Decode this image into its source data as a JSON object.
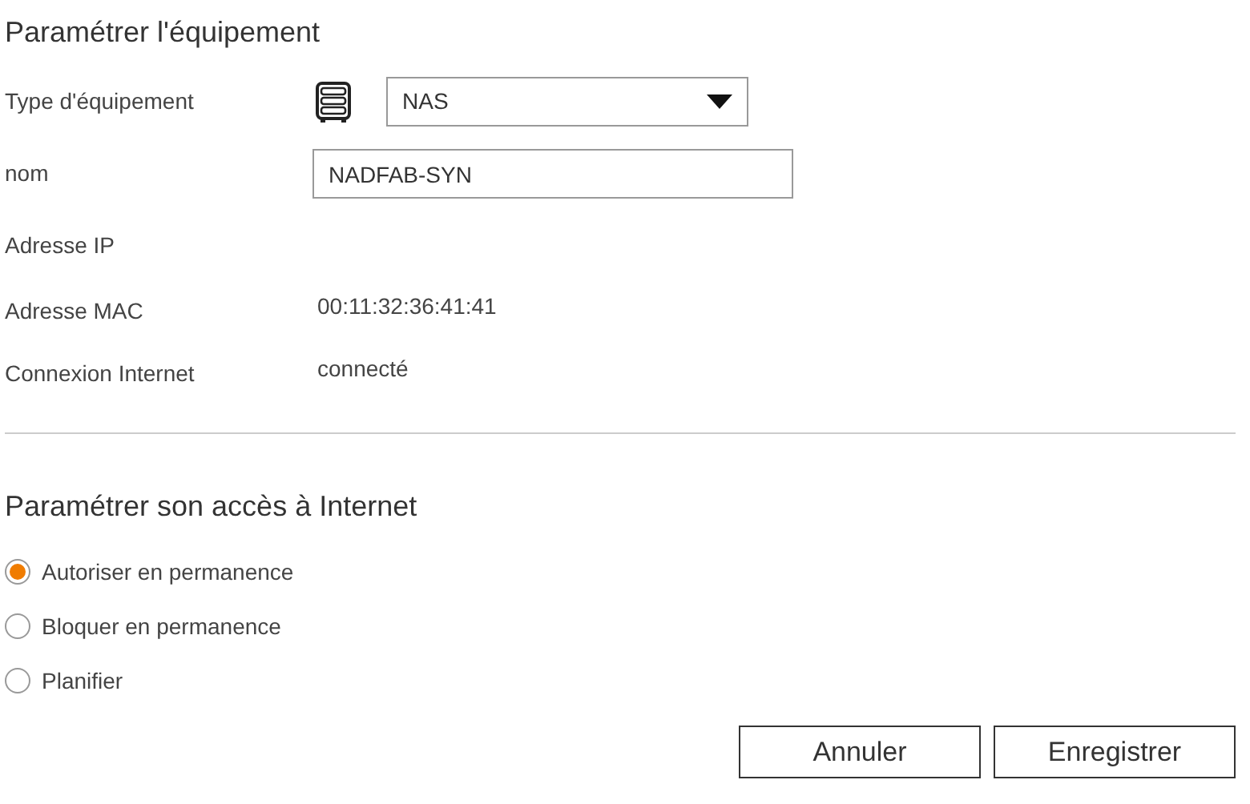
{
  "device_section": {
    "title": "Paramétrer l'équipement",
    "fields": [
      {
        "kind": "select",
        "label": "Type d'équipement",
        "value": "NAS"
      },
      {
        "kind": "input",
        "label": "nom",
        "value": "NADFAB-SYN"
      },
      {
        "kind": "text",
        "label": "Adresse IP"
      },
      {
        "kind": "text",
        "label": "Adresse MAC",
        "value": "00:11:32:36:41:41"
      },
      {
        "kind": "text",
        "label": "Connexion Internet",
        "value": "connecté"
      }
    ]
  },
  "access_section": {
    "title": "Paramétrer son accès à Internet",
    "options": [
      {
        "label": "Autoriser en permanence",
        "selected": true
      },
      {
        "label": "Bloquer en permanence",
        "selected": false
      },
      {
        "label": "Planifier",
        "selected": false
      }
    ]
  },
  "buttons": [
    "Annuler",
    "Enregistrer"
  ]
}
